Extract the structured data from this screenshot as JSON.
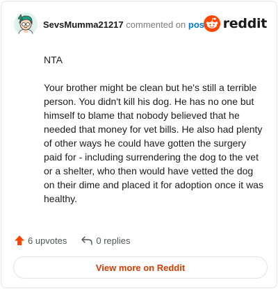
{
  "comment": {
    "username": "SevsMumma21217",
    "action_text": "commented on",
    "post_link": "post",
    "brand": "reddit",
    "paragraphs": [
      "NTA",
      "Your brother might be clean but he's still a terrible person. You didn't kill his dog. He has no one but himself to blame that nobody believed that he needed that money for vet bills. He also had plenty of other ways he could have gotten the surgery paid for - including surrendering the dog to the vet or a shelter, who then would have vetted the dog on their dime and placed it for adoption once it was healthy."
    ],
    "upvotes_label": "6 upvotes",
    "replies_label": "0 replies",
    "view_more_label": "View more on Reddit"
  },
  "icons": {
    "avatar": "avatar-icon",
    "brand": "reddit-logo-icon",
    "upvote": "upvote-arrow-icon",
    "reply": "reply-arrow-icon"
  },
  "colors": {
    "username": "#1a1a1b",
    "post_link": "#0079d3",
    "reddit_orange": "#ff4500",
    "upvote": "#ff4500",
    "view_more": "#d93a00"
  }
}
